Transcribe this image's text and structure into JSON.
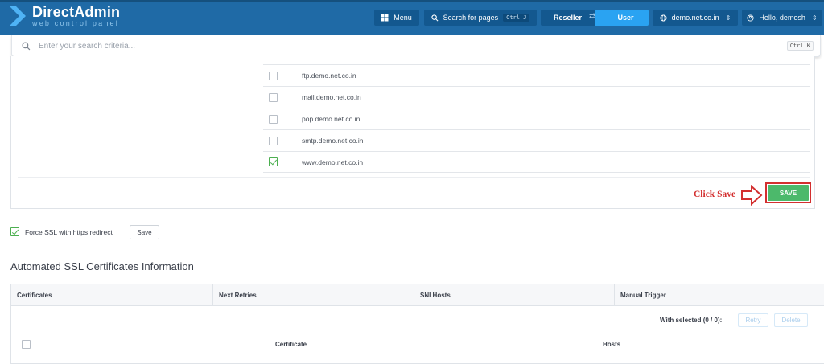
{
  "header": {
    "logo_title": "DirectAdmin",
    "logo_subtitle": "web control panel",
    "menu_label": "Menu",
    "search_pages_label": "Search for pages",
    "search_pages_shortcut": "Ctrl J",
    "reseller_label": "Reseller",
    "user_label": "User",
    "domain_label": "demo.net.co.in",
    "hello_label": "Hello, demosh"
  },
  "search": {
    "placeholder": "Enter your search criteria...",
    "shortcut": "Ctrl K"
  },
  "domains": {
    "items": [
      {
        "name": "ftp.demo.net.co.in",
        "checked": false
      },
      {
        "name": "mail.demo.net.co.in",
        "checked": false
      },
      {
        "name": "pop.demo.net.co.in",
        "checked": false
      },
      {
        "name": "smtp.demo.net.co.in",
        "checked": false
      },
      {
        "name": "www.demo.net.co.in",
        "checked": true
      }
    ],
    "annotation": "Click Save",
    "save_label": "SAVE"
  },
  "force_ssl": {
    "label": "Force SSL with https redirect",
    "checked": true,
    "save_label": "Save"
  },
  "automated": {
    "title": "Automated SSL Certificates Information",
    "columns": [
      "Certificates",
      "Next Retries",
      "SNI Hosts",
      "Manual Trigger"
    ],
    "with_selected": "With selected (0 / 0):",
    "retry_label": "Retry",
    "delete_label": "Delete",
    "sub_columns": [
      "Certificate",
      "Hosts"
    ]
  },
  "colors": {
    "header_bg": "#1f6aa6",
    "accent": "#2aa3f2",
    "save_green": "#4cb96b",
    "annotation_red": "#d32f2f"
  }
}
